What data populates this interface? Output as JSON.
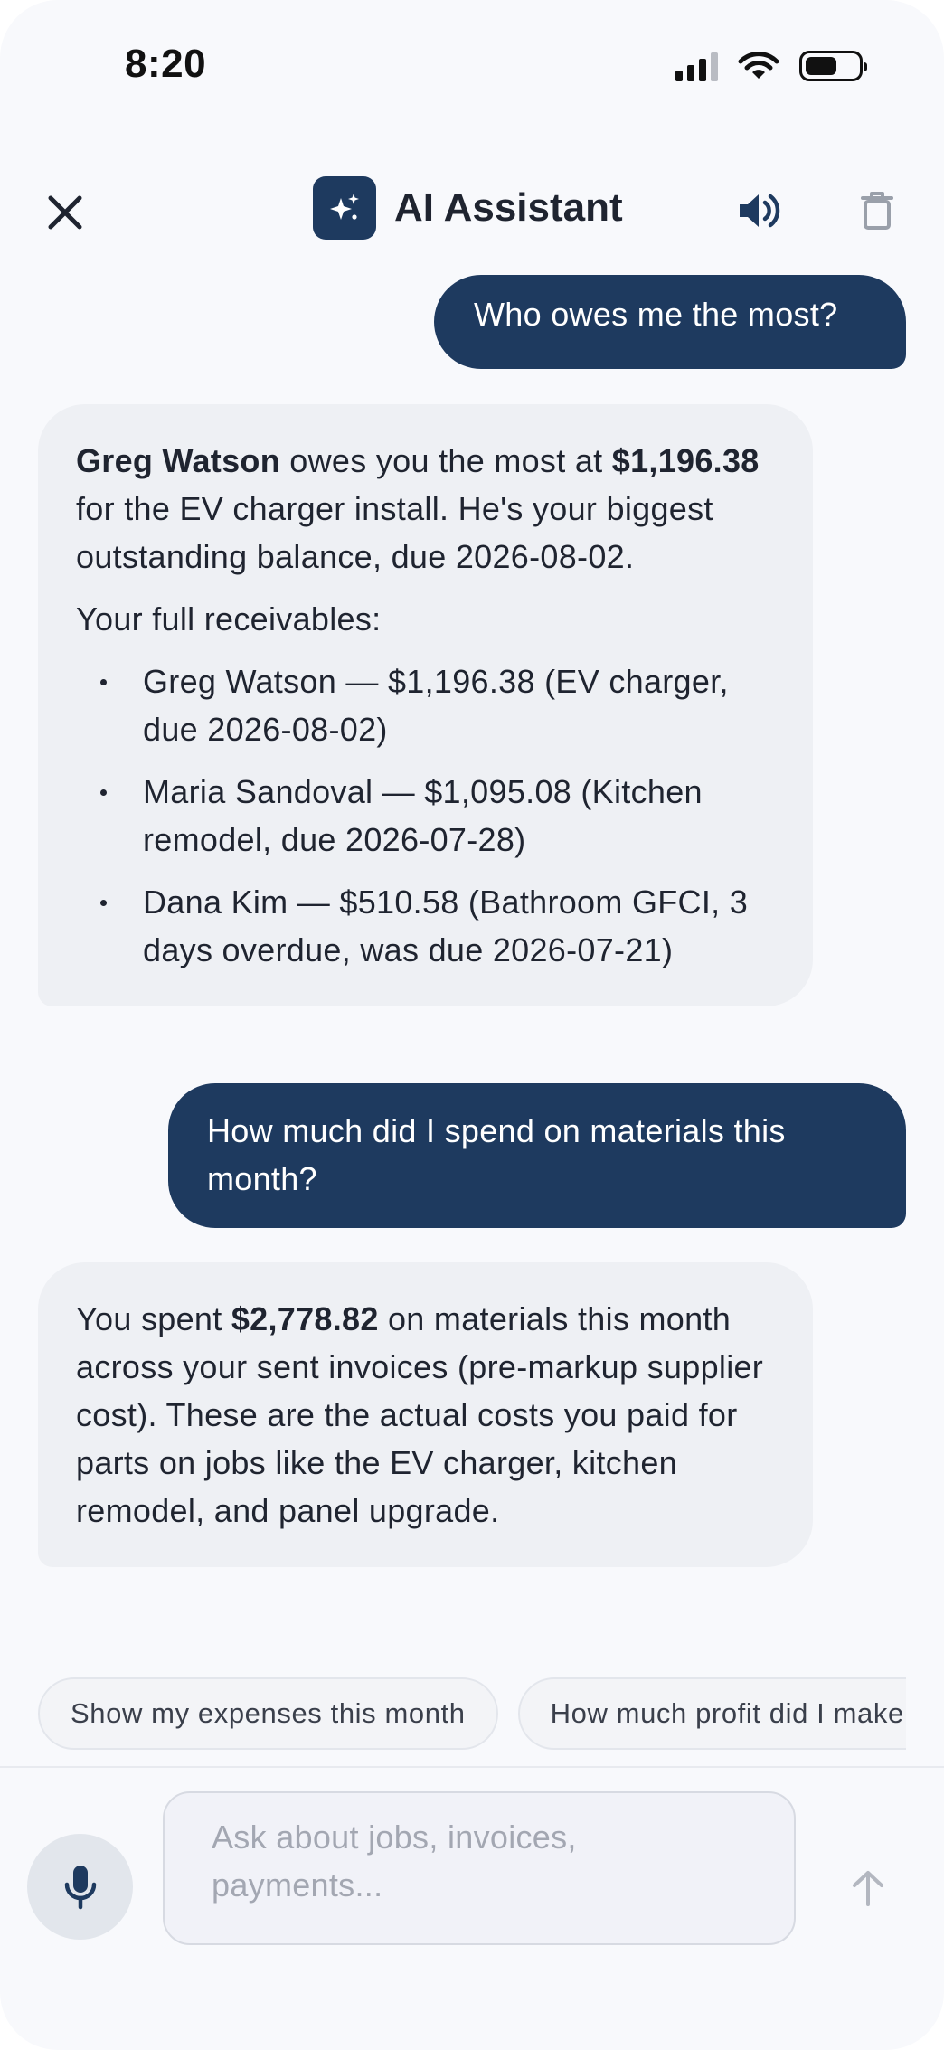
{
  "status_bar": {
    "time": "8:20",
    "battery_level": 0.6
  },
  "header": {
    "title": "AI Assistant",
    "icons": [
      "close-icon",
      "sparkles-icon",
      "speaker-icon",
      "trash-icon"
    ]
  },
  "messages": [
    {
      "role": "user",
      "text": "Who owes me the most?"
    },
    {
      "role": "assistant",
      "intro_bold_name": "Greg Watson",
      "intro_mid": " owes you the most at ",
      "intro_bold_amount": "$1,196.38",
      "intro_rest": " for the EV charger install. He's your biggest outstanding balance, due 2026-08-02.",
      "list_heading": "Your full receivables:",
      "items": [
        "Greg Watson — $1,196.38 (EV charger, due 2026-08-02)",
        "Maria Sandoval — $1,095.08 (Kitchen remodel, due 2026-07-28)",
        "Dana Kim — $510.58 (Bathroom GFCI, 3 days overdue, was due 2026-07-21)"
      ]
    },
    {
      "role": "user",
      "text": "How much did I spend on materials this month?"
    },
    {
      "role": "assistant",
      "pre": "You spent ",
      "bold_amount": "$2,778.82",
      "rest": " on materials this month across your sent invoices (pre-markup supplier cost). These are the actual costs you paid for parts on jobs like the EV charger, kitchen remodel, and panel upgrade."
    }
  ],
  "suggestions": [
    "Show my expenses this month",
    "How much profit did I make this month?"
  ],
  "composer": {
    "placeholder": "Ask about jobs, invoices, payments...",
    "value": ""
  },
  "colors": {
    "accent": "#1e3a5f",
    "assistant_bubble": "#eef0f4",
    "background": "#f8f9fc"
  }
}
